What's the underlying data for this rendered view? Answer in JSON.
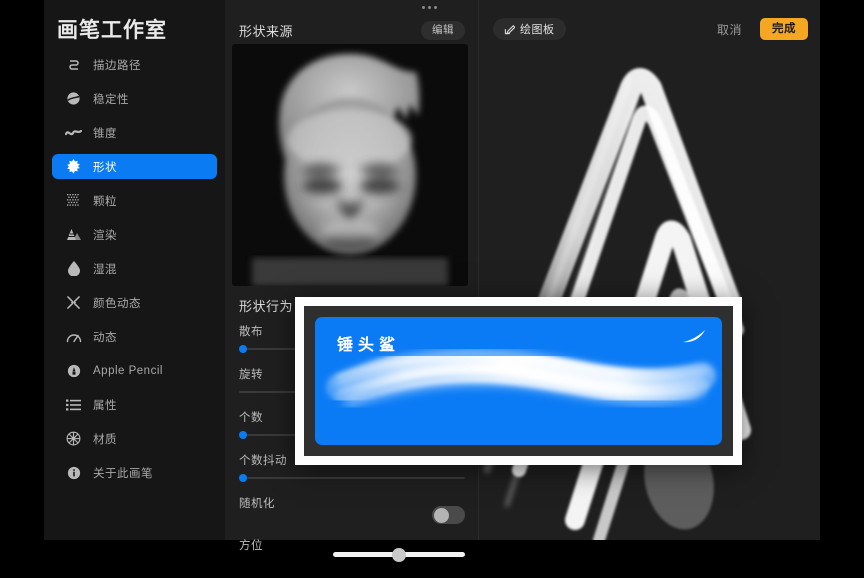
{
  "sidebar": {
    "title": "画笔工作室",
    "items": [
      {
        "label": "描边路径",
        "icon": "stroke-path-icon",
        "active": false
      },
      {
        "label": "稳定性",
        "icon": "stabilization-icon",
        "active": false
      },
      {
        "label": "锥度",
        "icon": "taper-icon",
        "active": false
      },
      {
        "label": "形状",
        "icon": "shape-icon",
        "active": true
      },
      {
        "label": "颗粒",
        "icon": "grain-icon",
        "active": false
      },
      {
        "label": "渲染",
        "icon": "rendering-icon",
        "active": false
      },
      {
        "label": "湿混",
        "icon": "wet-mix-icon",
        "active": false
      },
      {
        "label": "颜色动态",
        "icon": "color-dynamics-icon",
        "active": false
      },
      {
        "label": "动态",
        "icon": "dynamics-icon",
        "active": false
      },
      {
        "label": "Apple Pencil",
        "icon": "apple-pencil-icon",
        "active": false
      },
      {
        "label": "属性",
        "icon": "properties-icon",
        "active": false
      },
      {
        "label": "材质",
        "icon": "materials-icon",
        "active": false
      },
      {
        "label": "关于此画笔",
        "icon": "about-brush-icon",
        "active": false
      }
    ]
  },
  "middle": {
    "menu_dots": "more-options",
    "shape_source_title": "形状来源",
    "edit_label": "编辑",
    "shape_behavior_title": "形状行为",
    "rows": [
      {
        "label": "散布",
        "type": "slider",
        "value_pct": 2
      },
      {
        "label": "旋转",
        "type": "slider-empty",
        "value_pct": 0
      },
      {
        "label": "个数",
        "type": "slider",
        "value_pct": 2
      },
      {
        "label": "个数抖动",
        "type": "slider",
        "value_pct": 2
      },
      {
        "label": "随机化",
        "type": "toggle",
        "on": false
      },
      {
        "label": "方位",
        "type": "big-slider",
        "value_pct": 50
      }
    ]
  },
  "right": {
    "drawing_pad_label": "绘图板",
    "drawing_pad_icon": "pencil-edit-icon",
    "cancel_label": "取消",
    "done_label": "完成"
  },
  "brush_card": {
    "name": "锤头鲨",
    "accent_color": "#0b7bf5",
    "stroke_color": "#ffffff",
    "mark_icon": "brush-stroke-mark-icon"
  }
}
